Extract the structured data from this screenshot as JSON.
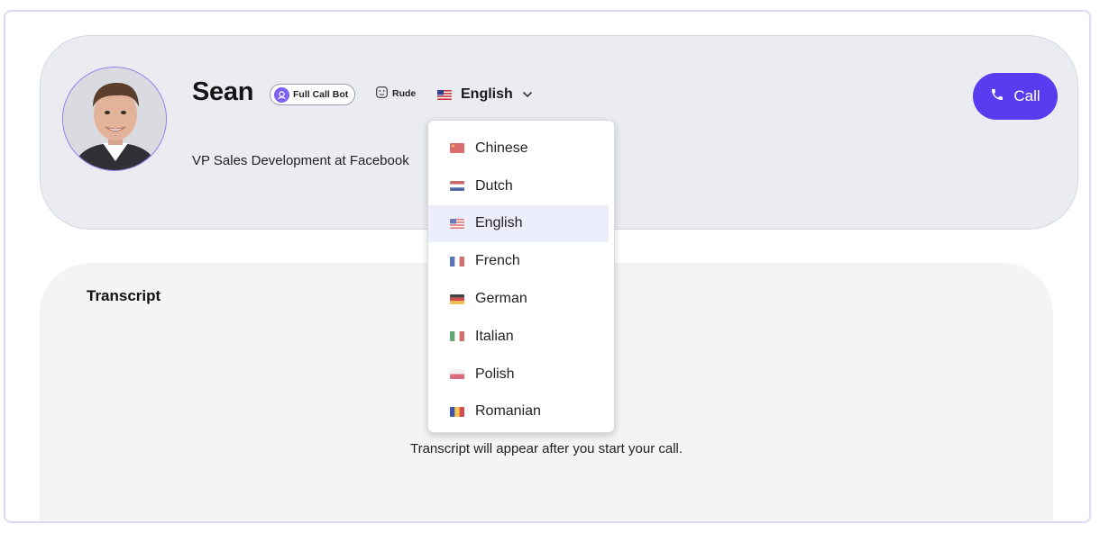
{
  "profile": {
    "name": "Sean",
    "title": "VP Sales Development at Facebook",
    "bot_badge_label": "Full Call Bot",
    "persona_label": "Rude",
    "selected_language": "English"
  },
  "call_button": {
    "label": "Call",
    "color": "#5a3cf0"
  },
  "transcript": {
    "title": "Transcript",
    "empty_message": "Transcript will appear after you start your call."
  },
  "language_dropdown": {
    "options": [
      {
        "label": "Chinese",
        "flag": "cn-flag-icon"
      },
      {
        "label": "Dutch",
        "flag": "nl-flag-icon"
      },
      {
        "label": "English",
        "flag": "us-flag-icon",
        "selected": true
      },
      {
        "label": "French",
        "flag": "fr-flag-icon"
      },
      {
        "label": "German",
        "flag": "de-flag-icon"
      },
      {
        "label": "Italian",
        "flag": "it-flag-icon"
      },
      {
        "label": "Polish",
        "flag": "pl-flag-icon"
      },
      {
        "label": "Romanian",
        "flag": "ro-flag-icon"
      }
    ]
  }
}
